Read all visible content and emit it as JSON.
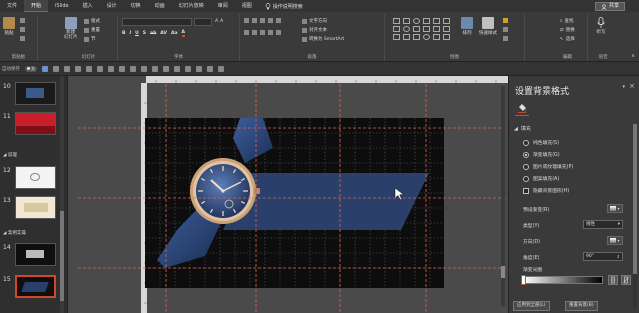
{
  "tabs": [
    {
      "label": "文件",
      "active": false
    },
    {
      "label": "开始",
      "active": true
    },
    {
      "label": "iSlide",
      "active": false
    },
    {
      "label": "插入",
      "active": false
    },
    {
      "label": "设计",
      "active": false
    },
    {
      "label": "切换",
      "active": false
    },
    {
      "label": "动画",
      "active": false
    },
    {
      "label": "幻灯片放映",
      "active": false
    },
    {
      "label": "审阅",
      "active": false
    },
    {
      "label": "视图",
      "active": false
    }
  ],
  "tell_me": "操作说明搜索",
  "share_label": "共享",
  "ribbon": {
    "clipboard": {
      "paste": "粘贴",
      "group": "剪贴板"
    },
    "slides": {
      "new_slide": "新建\n幻灯片",
      "layout": "版式",
      "reset": "重置",
      "section": "节",
      "group": "幻灯片"
    },
    "font": {
      "group": "字体"
    },
    "paragraph": {
      "text_direction": "文字方向",
      "align_text": "对齐文本",
      "smartart": "转换为 SmartArt",
      "group": "段落"
    },
    "drawing": {
      "arrange": "排列",
      "quick_styles": "快速样式",
      "group": "绘图"
    },
    "editing": {
      "find": "查找",
      "replace": "替换",
      "select": "选择",
      "group": "编辑"
    },
    "voice": {
      "dictate": "听写",
      "group": "语音"
    }
  },
  "qat": {
    "autosave": "自动保存",
    "autosave_state": "关"
  },
  "thumbnails": [
    {
      "number": "10"
    },
    {
      "number": "11"
    },
    {
      "number": "12"
    },
    {
      "number": "13"
    },
    {
      "number": "14"
    },
    {
      "number": "15",
      "selected": true
    }
  ],
  "sections": [
    {
      "label": "◢ 说理"
    },
    {
      "label": "◢ 案例实操"
    }
  ],
  "format_pane": {
    "title": "设置背景格式",
    "fill_header": "填充",
    "fill_options": [
      {
        "label": "纯色填充(S)",
        "selected": false
      },
      {
        "label": "渐变填充(G)",
        "selected": true
      },
      {
        "label": "图片或纹理填充(P)",
        "selected": false
      },
      {
        "label": "图案填充(A)",
        "selected": false
      }
    ],
    "hide_bg": "隐藏背景图形(H)",
    "preset_label": "预设渐变(R)",
    "type_label": "类型(Y)",
    "type_value": "线性",
    "direction_label": "方向(D)",
    "angle_label": "角度(E)",
    "angle_value": "90°",
    "stops_label": "渐变光圈",
    "apply_all": "应用到全部(L)",
    "reset_bg": "重置背景(B)"
  },
  "colors": {
    "accent": "#d24726",
    "guide": "#e06050",
    "band": "#2a3f6a"
  }
}
